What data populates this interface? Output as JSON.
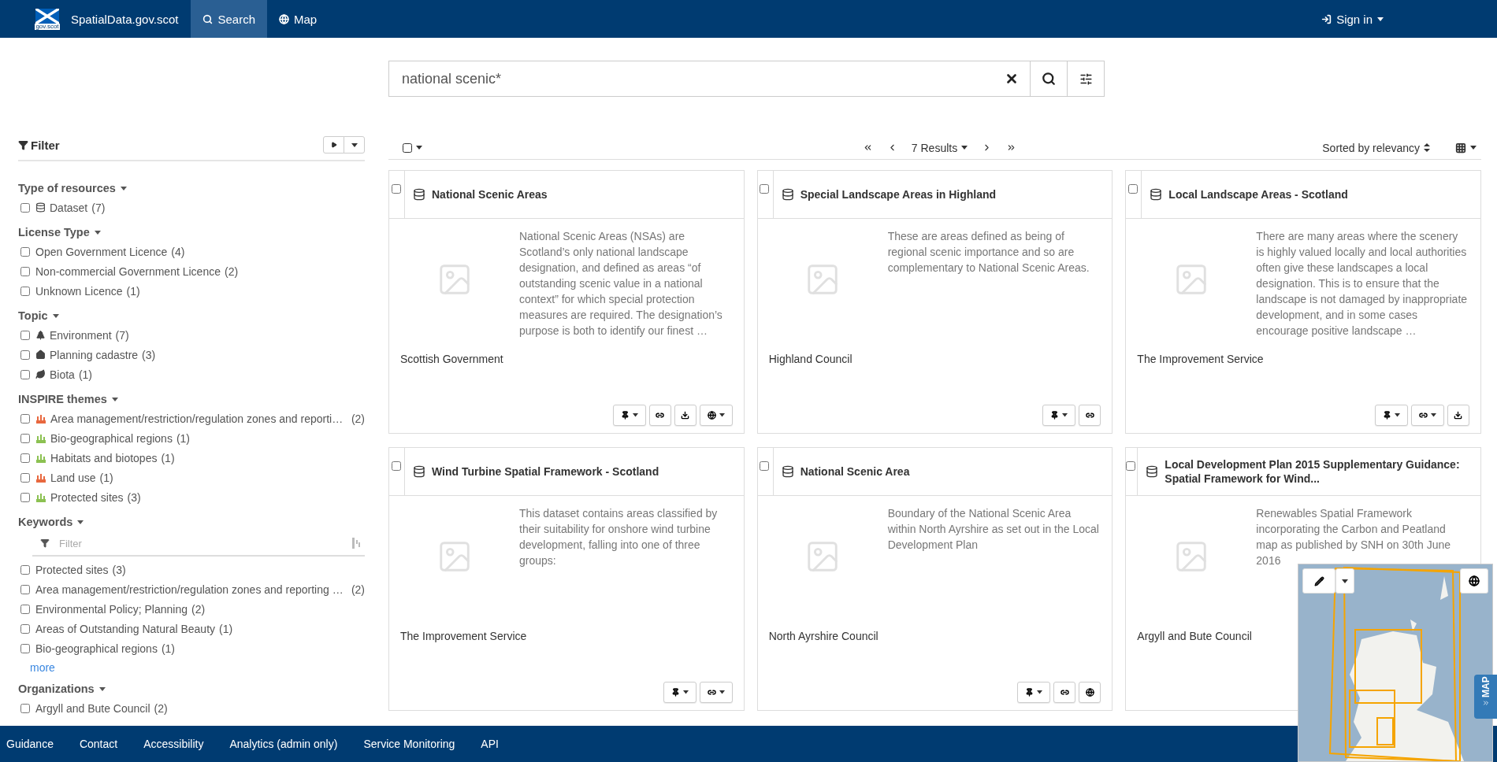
{
  "navbar": {
    "logo_text": "gov.scot",
    "brand": "SpatialData.gov.scot",
    "items": [
      {
        "label": "Search",
        "selected": true
      },
      {
        "label": "Map",
        "selected": false
      }
    ],
    "sign_in": "Sign in"
  },
  "search": {
    "value": "national scenic*"
  },
  "filter": {
    "title": "Filter",
    "facets": [
      {
        "title": "Type of resources",
        "items": [
          {
            "label": "Dataset",
            "count": "(7)",
            "kind": "dataset",
            "checked": false
          }
        ]
      },
      {
        "title": "License Type",
        "items": [
          {
            "label": "Open Government Licence",
            "count": "(4)",
            "checked": false
          },
          {
            "label": "Non-commercial Government Licence",
            "count": "(2)",
            "checked": false
          },
          {
            "label": "Unknown Licence",
            "count": "(1)",
            "checked": false
          }
        ]
      },
      {
        "title": "Topic",
        "items": [
          {
            "label": "Environment",
            "count": "(7)",
            "kind": "environment",
            "checked": false
          },
          {
            "label": "Planning cadastre",
            "count": "(3)",
            "kind": "planning",
            "checked": false
          },
          {
            "label": "Biota",
            "count": "(1)",
            "kind": "biota",
            "checked": false
          }
        ]
      },
      {
        "title": "INSPIRE themes",
        "items": [
          {
            "label": "Area management/restriction/regulation zones and reporti…",
            "count": "(2)",
            "kind": "management",
            "checked": false
          },
          {
            "label": "Bio-geographical regions",
            "count": "(1)",
            "kind": "biogeographical",
            "checked": false
          },
          {
            "label": "Habitats and biotopes",
            "count": "(1)",
            "kind": "habitats",
            "checked": false
          },
          {
            "label": "Land use",
            "count": "(1)",
            "kind": "landuse",
            "checked": false
          },
          {
            "label": "Protected sites",
            "count": "(3)",
            "kind": "protected",
            "checked": false
          }
        ]
      },
      {
        "title": "Keywords",
        "search_placeholder": "Filter",
        "items": [
          {
            "label": "Protected sites",
            "count": "(3)",
            "checked": false
          },
          {
            "label": "Area management/restriction/regulation zones and reporting …",
            "count": "(2)",
            "checked": false
          },
          {
            "label": "Environmental Policy; Planning",
            "count": "(2)",
            "checked": false
          },
          {
            "label": "Areas of Outstanding Natural Beauty",
            "count": "(1)",
            "checked": false
          },
          {
            "label": "Bio-geographical regions",
            "count": "(1)",
            "checked": false
          }
        ],
        "more": "more"
      },
      {
        "title": "Organizations",
        "items": [
          {
            "label": "Argyll and Bute Council",
            "count": "(2)",
            "checked": false
          }
        ]
      }
    ]
  },
  "results": {
    "select_all_checked": false,
    "count_label": "7 Results",
    "sort_label": "Sorted by relevancy",
    "cards": [
      {
        "title": "National Scenic Areas",
        "selected": false,
        "description": "National Scenic Areas (NSAs) are Scotland’s only national landscape designation, and defined as areas “of outstanding scenic value in a national context” for which special protection measures are required. The designation’s purpose is both to identify our finest …",
        "organization": "Scottish Government",
        "actions": [
          {
            "kind": "pin",
            "dropdown": true
          },
          {
            "kind": "link",
            "dropdown": false
          },
          {
            "kind": "download",
            "dropdown": false
          },
          {
            "kind": "globe",
            "dropdown": true
          }
        ]
      },
      {
        "title": "Special Landscape Areas in Highland",
        "selected": false,
        "description": "These are areas defined as being of regional scenic importance and so are complementary to National Scenic Areas.",
        "organization": "Highland Council",
        "actions": [
          {
            "kind": "pin",
            "dropdown": true
          },
          {
            "kind": "link",
            "dropdown": false
          }
        ]
      },
      {
        "title": "Local Landscape Areas - Scotland",
        "selected": false,
        "description": "There are many areas where the scenery is highly valued locally and local authorities often give these landscapes a local designation. This is to ensure that the landscape is not damaged by inappropriate development, and in some cases encourage positive landscape …",
        "organization": "The Improvement Service",
        "actions": [
          {
            "kind": "pin",
            "dropdown": true
          },
          {
            "kind": "link",
            "dropdown": true
          },
          {
            "kind": "download",
            "dropdown": false
          }
        ]
      },
      {
        "title": "Wind Turbine Spatial Framework - Scotland",
        "selected": false,
        "description": "This dataset contains areas classified by their suitability for onshore wind turbine development, falling into one of three groups:",
        "organization": "The Improvement Service",
        "actions": [
          {
            "kind": "pin",
            "dropdown": true
          },
          {
            "kind": "link",
            "dropdown": true
          }
        ]
      },
      {
        "title": "National Scenic Area",
        "selected": false,
        "description": "Boundary of the National Scenic Area within North Ayrshire as set out in the Local Development Plan",
        "organization": "North Ayrshire Council",
        "actions": [
          {
            "kind": "pin",
            "dropdown": true
          },
          {
            "kind": "link",
            "dropdown": false
          },
          {
            "kind": "globe",
            "dropdown": false
          }
        ]
      },
      {
        "title": "Local Development Plan 2015 Supplementary Guidance: Spatial Framework for Wind...",
        "selected": false,
        "description": "Renewables Spatial Framework incorporating the Carbon and Peatland map as published by SNH on 30th June 2016",
        "organization": "Argyll and Bute Council"
      }
    ]
  },
  "map_panel": {
    "tab_label": "MAP"
  },
  "footer": {
    "links": [
      "Guidance",
      "Contact",
      "Accessibility",
      "Analytics (admin only)",
      "Service Monitoring",
      "API"
    ]
  }
}
